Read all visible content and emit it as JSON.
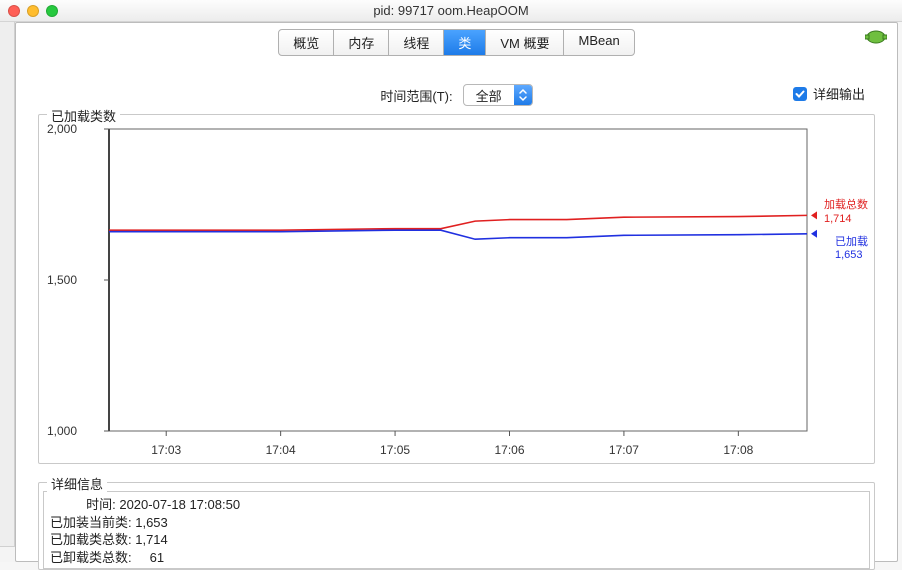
{
  "window": {
    "title": "pid: 99717 oom.HeapOOM"
  },
  "tabs": {
    "items": [
      "概览",
      "内存",
      "线程",
      "类",
      "VM 概要",
      "MBean"
    ],
    "active_index": 3
  },
  "controls": {
    "time_range_label": "时间范围(T):",
    "time_range_value": "全部",
    "detail_output_label": "详细输出",
    "detail_output_checked": true
  },
  "chart_title": "已加载类数",
  "series_labels": {
    "total": {
      "name": "加载总数",
      "value": "1,714",
      "color": "#e02020"
    },
    "loaded": {
      "name": "已加载",
      "value": "1,653",
      "color": "#2030e0"
    }
  },
  "details": {
    "legend": "详细信息",
    "rows": [
      "          时间: 2020-07-18 17:08:50",
      "已加装当前类: 1,653",
      "已加载类总数: 1,714",
      "已卸载类总数:     61"
    ]
  },
  "chart_data": {
    "type": "line",
    "xlabel": "",
    "ylabel": "",
    "ylim": [
      1000,
      2000
    ],
    "y_ticks": [
      1000,
      1500,
      2000
    ],
    "x_ticks": [
      "17:03",
      "17:04",
      "17:05",
      "17:06",
      "17:07",
      "17:08"
    ],
    "x": [
      "17:02.5",
      "17:03",
      "17:04",
      "17:05",
      "17:05.4",
      "17:05.7",
      "17:06",
      "17:06.5",
      "17:07",
      "17:08",
      "17:08.6"
    ],
    "series": [
      {
        "name": "加载总数",
        "color": "#e02020",
        "values": [
          1665,
          1665,
          1665,
          1670,
          1670,
          1695,
          1700,
          1700,
          1708,
          1710,
          1714
        ]
      },
      {
        "name": "已加载",
        "color": "#2030e0",
        "values": [
          1660,
          1660,
          1660,
          1665,
          1665,
          1635,
          1640,
          1640,
          1648,
          1650,
          1653
        ]
      }
    ]
  }
}
